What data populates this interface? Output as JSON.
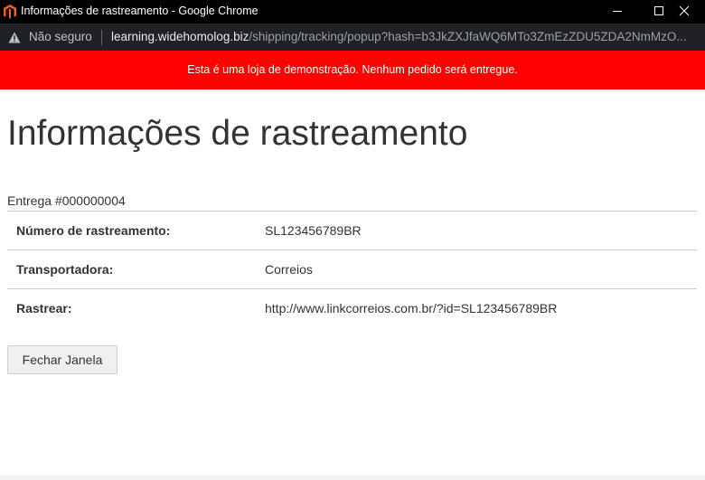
{
  "window": {
    "title": "Informações de rastreamento - Google Chrome"
  },
  "address_bar": {
    "security_label": "Não seguro",
    "url_host": "learning.widehomolog.biz",
    "url_path": "/shipping/tracking/popup?hash=b3JkZXJfaWQ6MTo3ZmEzZDU5ZDA2NmMzO..."
  },
  "banner": {
    "text": "Esta é uma loja de demonstração. Nenhum pedido será entregue.",
    "color": "#ff0101"
  },
  "page": {
    "title": "Informações de rastreamento",
    "shipment_caption": "Entrega #000000004",
    "rows": [
      {
        "label": "Número de rastreamento:",
        "value": "SL123456789BR"
      },
      {
        "label": "Transportadora:",
        "value": "Correios"
      },
      {
        "label": "Rastrear:",
        "value": "http://www.linkcorreios.com.br/?id=SL123456789BR"
      }
    ],
    "close_button_label": "Fechar Janela"
  },
  "icons": {
    "app": "magento-logo-icon",
    "security": "warning-triangle-icon",
    "minimize": "minimize-icon",
    "maximize": "maximize-icon",
    "close": "close-icon"
  }
}
